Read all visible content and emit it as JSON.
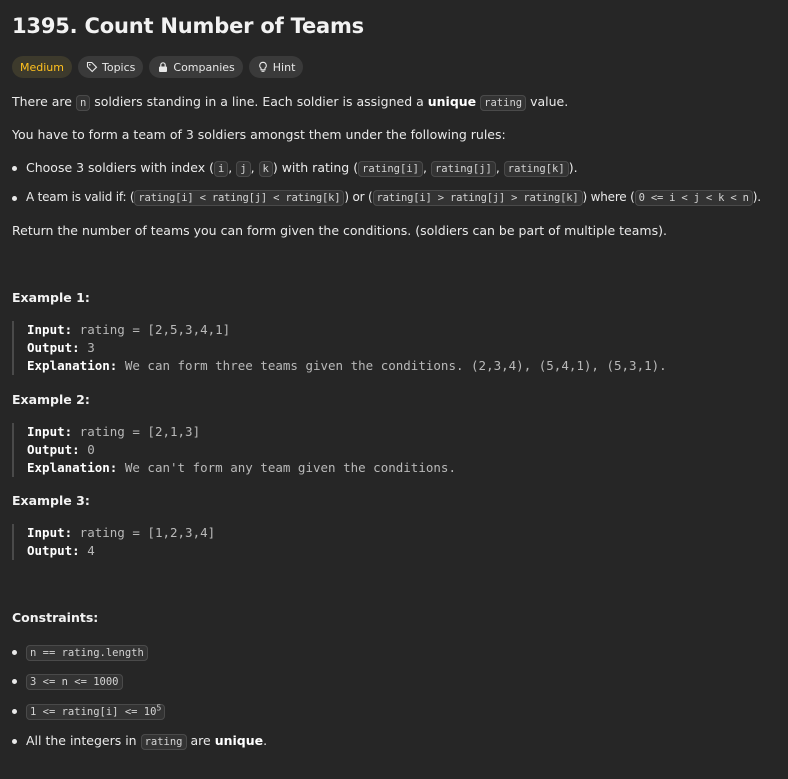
{
  "problem": {
    "title": "1395. Count Number of Teams",
    "difficulty": "Medium",
    "tags": {
      "topics": "Topics",
      "companies": "Companies",
      "hint": "Hint"
    }
  },
  "description": {
    "p1_pre": "There are ",
    "p1_code": "n",
    "p1_mid": " soldiers standing in a line. Each soldier is assigned a ",
    "p1_bold": "unique",
    "p1_code2": "rating",
    "p1_post": " value.",
    "p2": "You have to form a team of 3 soldiers amongst them under the following rules:",
    "b1_pre": "Choose 3 soldiers with index (",
    "b1_i": "i",
    "b1_j": "j",
    "b1_k": "k",
    "b1_mid": ") with rating (",
    "b1_ri": "rating[i]",
    "b1_rj": "rating[j]",
    "b1_rk": "rating[k]",
    "b1_post": ").",
    "b2_pre": "A team is valid if: (",
    "b2_c1": "rating[i] < rating[j] < rating[k]",
    "b2_or": ") or (",
    "b2_c2": "rating[i] > rating[j] > rating[k]",
    "b2_where": ") where (",
    "b2_c3": "0 <= i < j < k < n",
    "b2_post": ").",
    "p3": "Return the number of teams you can form given the conditions. (soldiers can be part of multiple teams)."
  },
  "examples": [
    {
      "title": "Example 1:",
      "input_label": "Input:",
      "input": " rating = [2,5,3,4,1]",
      "output_label": "Output:",
      "output": " 3",
      "explanation_label": "Explanation:",
      "explanation": " We can form three teams given the conditions. (2,3,4), (5,4,1), (5,3,1)."
    },
    {
      "title": "Example 2:",
      "input_label": "Input:",
      "input": " rating = [2,1,3]",
      "output_label": "Output:",
      "output": " 0",
      "explanation_label": "Explanation:",
      "explanation": " We can't form any team given the conditions."
    },
    {
      "title": "Example 3:",
      "input_label": "Input:",
      "input": " rating = [1,2,3,4]",
      "output_label": "Output:",
      "output": " 4"
    }
  ],
  "constraints": {
    "title": "Constraints:",
    "c1": "n == rating.length",
    "c2": "3 <= n <= 1000",
    "c3": "1 <= rating[i] <= 10",
    "c3_sup": "5",
    "c4_pre": "All the integers in ",
    "c4_code": "rating",
    "c4_mid": " are ",
    "c4_bold": "unique",
    "c4_post": "."
  },
  "colors": {
    "background": "#262626",
    "difficulty_medium": "#ffc01e"
  },
  "icons": [
    "tag-icon",
    "lock-icon",
    "lightbulb-icon"
  ]
}
